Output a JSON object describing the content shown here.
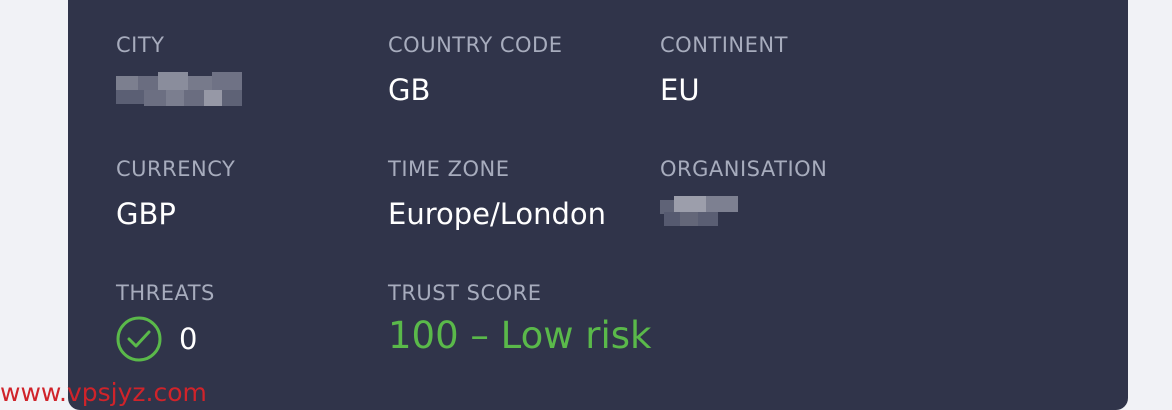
{
  "fields": {
    "city": {
      "label": "CITY",
      "value": ""
    },
    "country_code": {
      "label": "COUNTRY CODE",
      "value": "GB"
    },
    "continent": {
      "label": "CONTINENT",
      "value": "EU"
    },
    "currency": {
      "label": "CURRENCY",
      "value": "GBP"
    },
    "time_zone": {
      "label": "TIME ZONE",
      "value": "Europe/London"
    },
    "organisation": {
      "label": "ORGANISATION",
      "value": ""
    },
    "threats": {
      "label": "THREATS",
      "value": "0",
      "icon": "check-circle-icon"
    },
    "trust_score": {
      "label": "TRUST SCORE",
      "value": "100 – Low risk"
    }
  },
  "colors": {
    "card_bg": "#30344a",
    "label": "#a7acbd",
    "value": "#ffffff",
    "good": "#5ab94a",
    "page_bg": "#f1f2f6"
  },
  "watermark": "www.vpsjyz.com"
}
